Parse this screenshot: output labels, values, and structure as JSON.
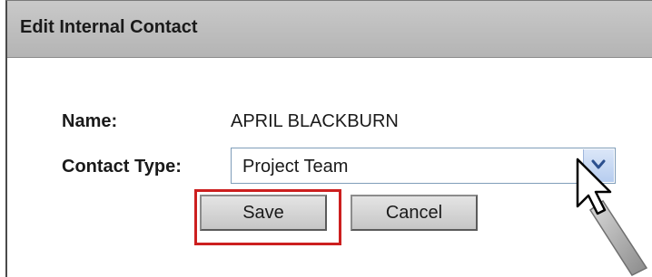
{
  "dialog": {
    "title": "Edit Internal Contact"
  },
  "form": {
    "name_label": "Name:",
    "name_value": "APRIL BLACKBURN",
    "contact_type_label": "Contact Type:",
    "contact_type_value": "Project Team"
  },
  "buttons": {
    "save_label": "Save",
    "cancel_label": "Cancel"
  },
  "colors": {
    "header_bg": "#c0c0c0",
    "highlight": "#cc1f1f",
    "dropdown_arrow_bg": "#c8daf3"
  },
  "icons": {
    "dropdown": "chevron-down-icon",
    "cursor": "mouse-pointer-icon"
  }
}
